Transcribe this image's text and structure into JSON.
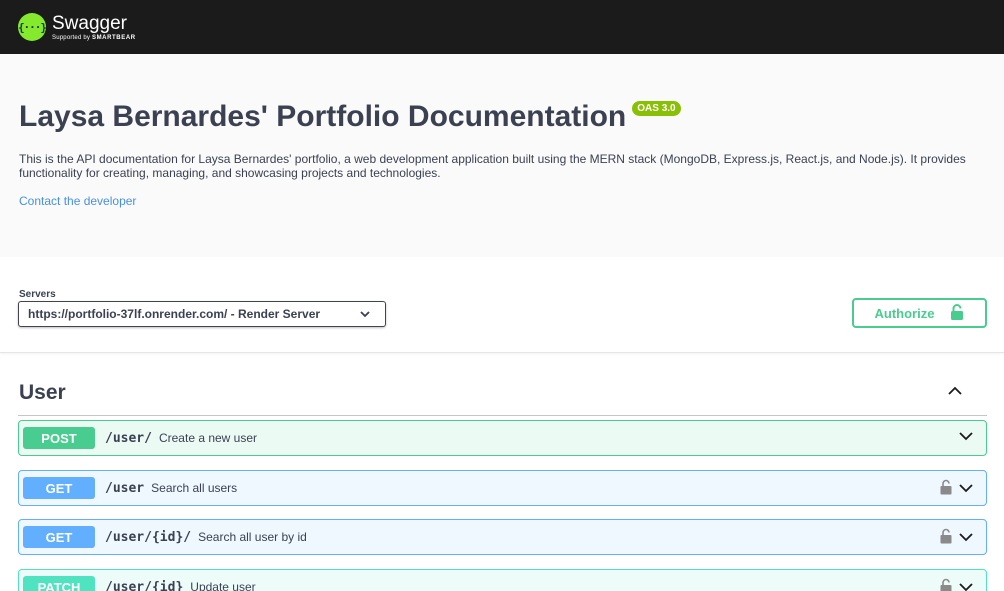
{
  "topbar": {
    "logo_mark": "{···}",
    "brand": "Swagger",
    "supported_prefix": "Supported by",
    "supported_brand": "SMARTBEAR"
  },
  "info": {
    "title": "Laysa Bernardes' Portfolio Documentation",
    "version_badge": "OAS 3.0",
    "description": "This is the API documentation for Laysa Bernardes' portfolio, a web development application built using the MERN stack (MongoDB, Express.js, React.js, and Node.js). It provides functionality for creating, managing, and showcasing projects and technologies.",
    "contact_link": "Contact the developer"
  },
  "servers": {
    "label": "Servers",
    "selected": "https://portfolio-37lf.onrender.com/ - Render Server"
  },
  "authorize": {
    "label": "Authorize",
    "icon": "unlocked-padlock-icon"
  },
  "tag": {
    "name": "User",
    "expanded": true
  },
  "operations": [
    {
      "method": "POST",
      "path": "/user/",
      "summary": "Create a new user",
      "locked": false
    },
    {
      "method": "GET",
      "path": "/user",
      "summary": "Search all users",
      "locked": true
    },
    {
      "method": "GET",
      "path": "/user/{id}/",
      "summary": "Search all user by id",
      "locked": true
    },
    {
      "method": "PATCH",
      "path": "/user/{id}",
      "summary": "Update user",
      "locked": true
    }
  ],
  "colors": {
    "topbar_bg": "#1b1b1b",
    "brand_green": "#85ea2d",
    "post": "#49cc90",
    "get": "#61affe",
    "patch": "#50e3c2",
    "link": "#4990e2",
    "badge": "#89bf04"
  }
}
